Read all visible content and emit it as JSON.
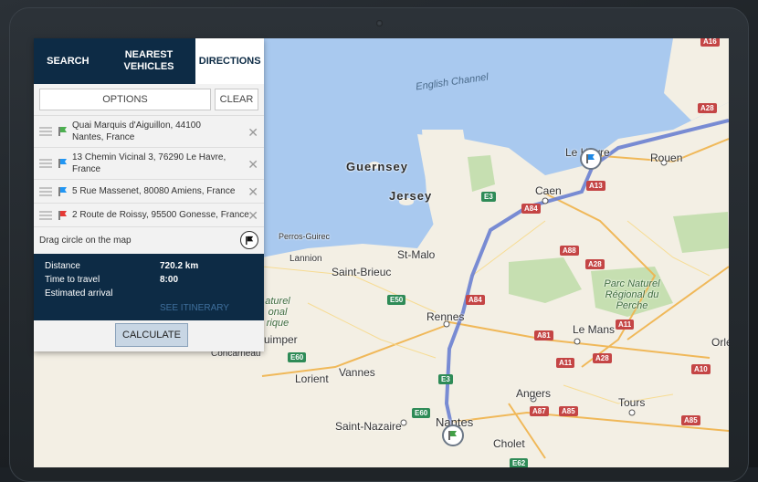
{
  "tabs": {
    "search": "SEARCH",
    "nearest": "NEAREST VEHICLES",
    "directions": "DIRECTIONS"
  },
  "buttons": {
    "options": "OPTIONS",
    "clear": "CLEAR",
    "calculate": "CALCULATE"
  },
  "stops": [
    {
      "address": "Quai Marquis d'Aiguillon, 44100 Nantes, France",
      "flag_color": "#4caf50"
    },
    {
      "address": "13 Chemin Vicinal 3, 76290 Le Havre, France",
      "flag_color": "#2196f3"
    },
    {
      "address": "5 Rue Massenet, 80080 Amiens, France",
      "flag_color": "#2196f3"
    },
    {
      "address": "2 Route de Roissy, 95500 Gonesse, France",
      "flag_color": "#e53935"
    }
  ],
  "hint": "Drag circle on the map",
  "summary": {
    "distance_label": "Distance",
    "distance_value": "720.2 km",
    "time_label": "Time to travel",
    "time_value": "8:00",
    "arrival_label": "Estimated arrival",
    "itinerary_link": "SEE ITINERARY"
  },
  "map": {
    "labels": {
      "english_channel": "English Channel",
      "guernsey": "Guernsey",
      "jersey": "Jersey",
      "le_havre": "Le Havre",
      "rouen": "Rouen",
      "caen": "Caen",
      "perros": "Perros-Guirec",
      "lannion": "Lannion",
      "saint_brieuc": "Saint-Brieuc",
      "st_malo": "St-Malo",
      "rennes": "Rennes",
      "le_mans": "Le Mans",
      "quimper": "uimper",
      "concarneau": "Concarneau",
      "lorient": "Lorient",
      "vannes": "Vannes",
      "angers": "Angers",
      "tours": "Tours",
      "saint_nazaire": "Saint-Nazaire",
      "nantes": "Nantes",
      "cholet": "Cholet",
      "orleans": "Orlé",
      "park": "Parc Naturel Régional du Perche",
      "park_left": "aturel onal rique"
    },
    "roads": [
      "A16",
      "A28",
      "A13",
      "E3",
      "A84",
      "A88",
      "A28",
      "E50",
      "A84",
      "A11",
      "A81",
      "A11",
      "A28",
      "A10",
      "E60",
      "E3",
      "A87",
      "A85",
      "A85",
      "E60",
      "E62"
    ],
    "route_color": "#6a7fd0"
  }
}
